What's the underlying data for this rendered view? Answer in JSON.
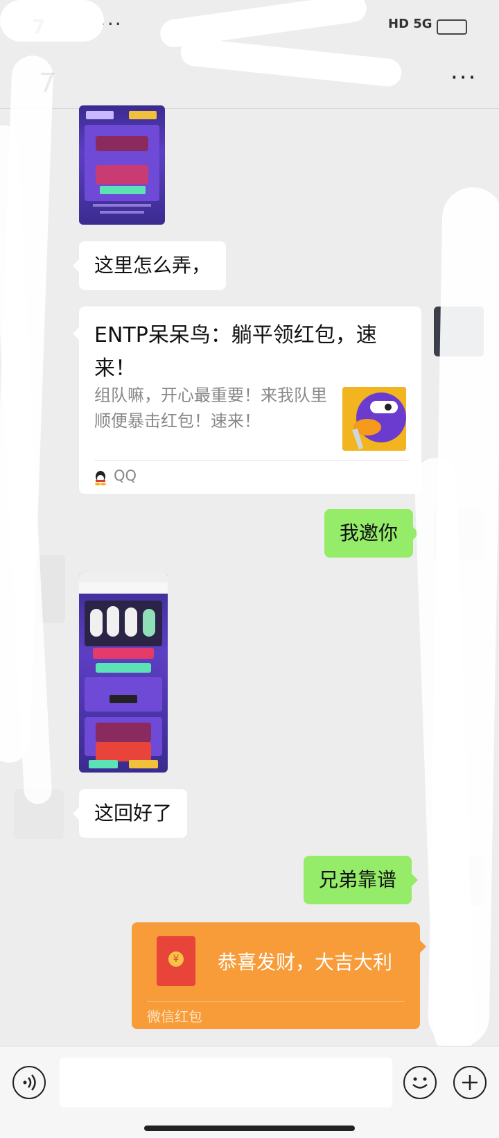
{
  "status_bar": {
    "time": "7",
    "dots": "···",
    "network": "HD 5G"
  },
  "header": {
    "back_label": "7",
    "more_label": "···"
  },
  "messages": [
    {
      "type": "text",
      "side": "left",
      "text": "这里怎么弄，"
    },
    {
      "type": "link",
      "side": "left",
      "title": "ENTP呆呆鸟：躺平领红包，速来！",
      "description": "组队嘛，开心最重要！来我队里顺便暴击红包！速来！",
      "source": "QQ"
    },
    {
      "type": "text",
      "side": "right",
      "text": "我邀你"
    },
    {
      "type": "text",
      "side": "left",
      "text": "这回好了"
    },
    {
      "type": "text",
      "side": "right",
      "text": "兄弟靠谱"
    },
    {
      "type": "red_packet",
      "side": "right",
      "text": "恭喜发财，大吉大利",
      "label": "微信红包",
      "coin": "¥"
    }
  ],
  "colors": {
    "right_bubble": "#95ec69",
    "red_packet": "#f79c38",
    "background": "#ededed"
  },
  "input_bar": {
    "voice_icon": "voice-icon",
    "emoji_icon": "emoji-icon",
    "plus_icon": "plus-icon"
  }
}
